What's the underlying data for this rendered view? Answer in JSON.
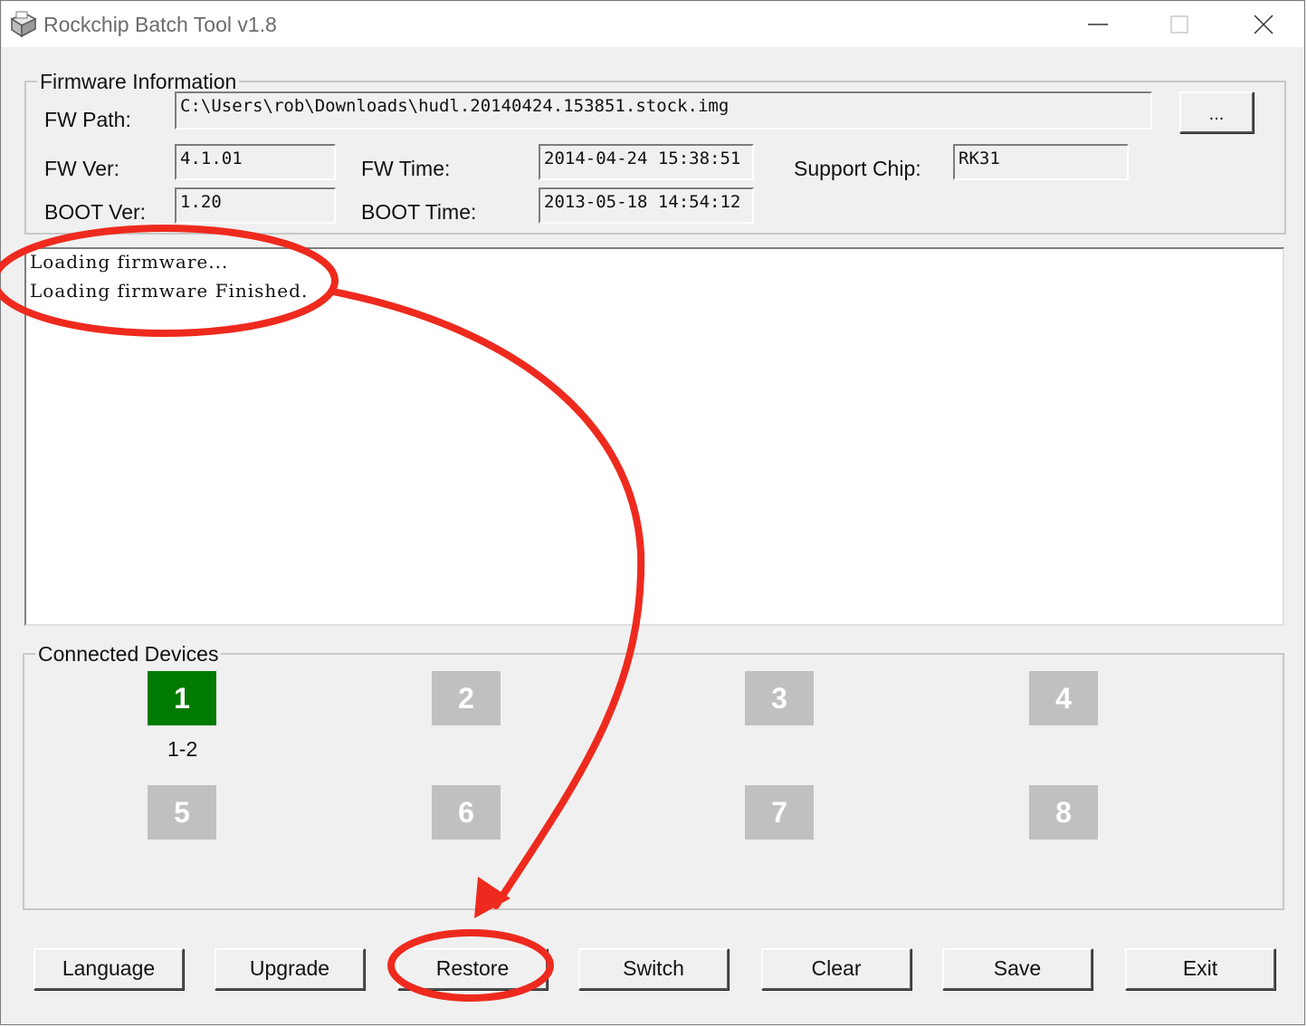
{
  "window": {
    "title": "Rockchip Batch Tool v1.8",
    "icons": [
      "app-icon",
      "minimize-icon",
      "maximize-icon",
      "close-icon"
    ]
  },
  "firmware": {
    "group_title": "Firmware Information",
    "fw_path_label": "FW Path:",
    "fw_path_value": "C:\\Users\\rob\\Downloads\\hudl.20140424.153851.stock.img",
    "browse_label": "...",
    "fw_ver_label": "FW Ver:",
    "fw_ver_value": "4.1.01",
    "fw_time_label": "FW Time:",
    "fw_time_value": "2014-04-24 15:38:51",
    "support_chip_label": "Support Chip:",
    "support_chip_value": "RK31",
    "boot_ver_label": "BOOT Ver:",
    "boot_ver_value": "1.20",
    "boot_time_label": "BOOT Time:",
    "boot_time_value": "2013-05-18 14:54:12"
  },
  "log": {
    "lines": [
      "Loading firmware...",
      "Loading firmware Finished."
    ]
  },
  "devices": {
    "group_title": "Connected Devices",
    "slots": [
      {
        "label": "1",
        "active": true,
        "port": "1-2"
      },
      {
        "label": "2",
        "active": false
      },
      {
        "label": "3",
        "active": false
      },
      {
        "label": "4",
        "active": false
      },
      {
        "label": "5",
        "active": false
      },
      {
        "label": "6",
        "active": false
      },
      {
        "label": "7",
        "active": false
      },
      {
        "label": "8",
        "active": false
      }
    ]
  },
  "buttons": {
    "language": "Language",
    "upgrade": "Upgrade",
    "restore": "Restore",
    "switch": "Switch",
    "clear": "Clear",
    "save": "Save",
    "exit": "Exit"
  },
  "colors": {
    "active_device": "#007a00",
    "inactive_device": "#c0c0c0",
    "annotation": "#ee2a1e"
  }
}
